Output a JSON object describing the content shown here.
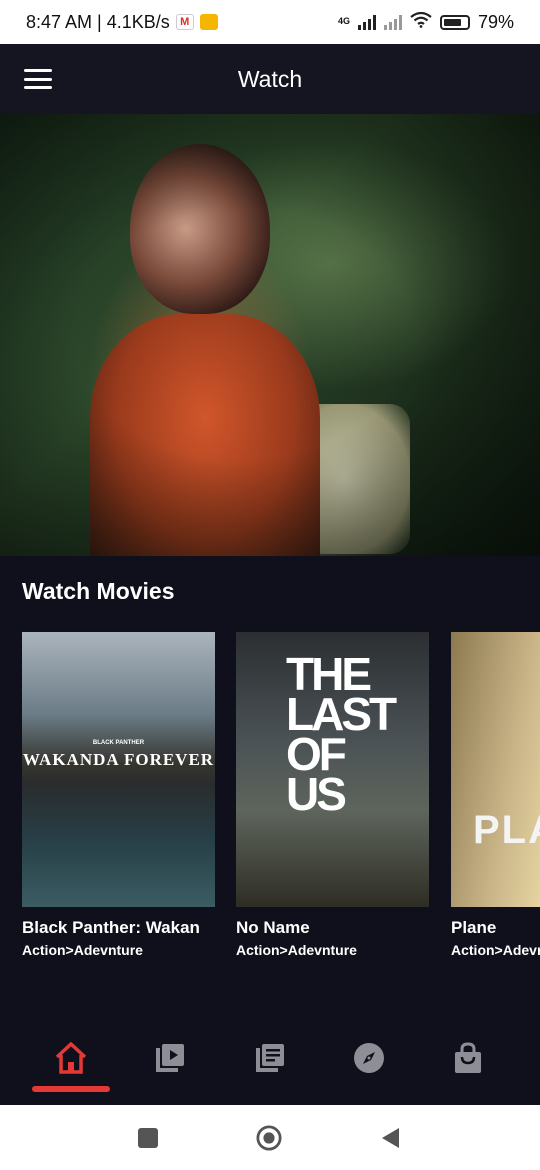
{
  "status_bar": {
    "time_speed": "8:47 AM | 4.1KB/s",
    "network": "4G",
    "battery": "79%",
    "battery_level": 0.79
  },
  "app_bar": {
    "title": "Watch",
    "menu_icon": "hamburger-menu-icon"
  },
  "section": {
    "title": "Watch Movies"
  },
  "movies": [
    {
      "title": "Black Panther: Wakan",
      "genre": "Action>Adevnture",
      "poster_text": "WAKANDA FOREVER",
      "poster_small": "BLACK PANTHER"
    },
    {
      "title": "No Name",
      "genre": "Action>Adevnture",
      "poster_text": "THE LAST OF US"
    },
    {
      "title": "Plane",
      "genre": "Action>Adevnture",
      "poster_text": "PLA"
    }
  ],
  "bottom_nav": [
    {
      "icon": "home-icon",
      "active": true
    },
    {
      "icon": "video-library-icon",
      "active": false
    },
    {
      "icon": "library-books-icon",
      "active": false
    },
    {
      "icon": "compass-icon",
      "active": false
    },
    {
      "icon": "shopping-bag-icon",
      "active": false
    }
  ],
  "colors": {
    "background": "#10101c",
    "app_bar": "#151522",
    "accent": "#e53935",
    "inactive_icon": "#8e8e96"
  }
}
